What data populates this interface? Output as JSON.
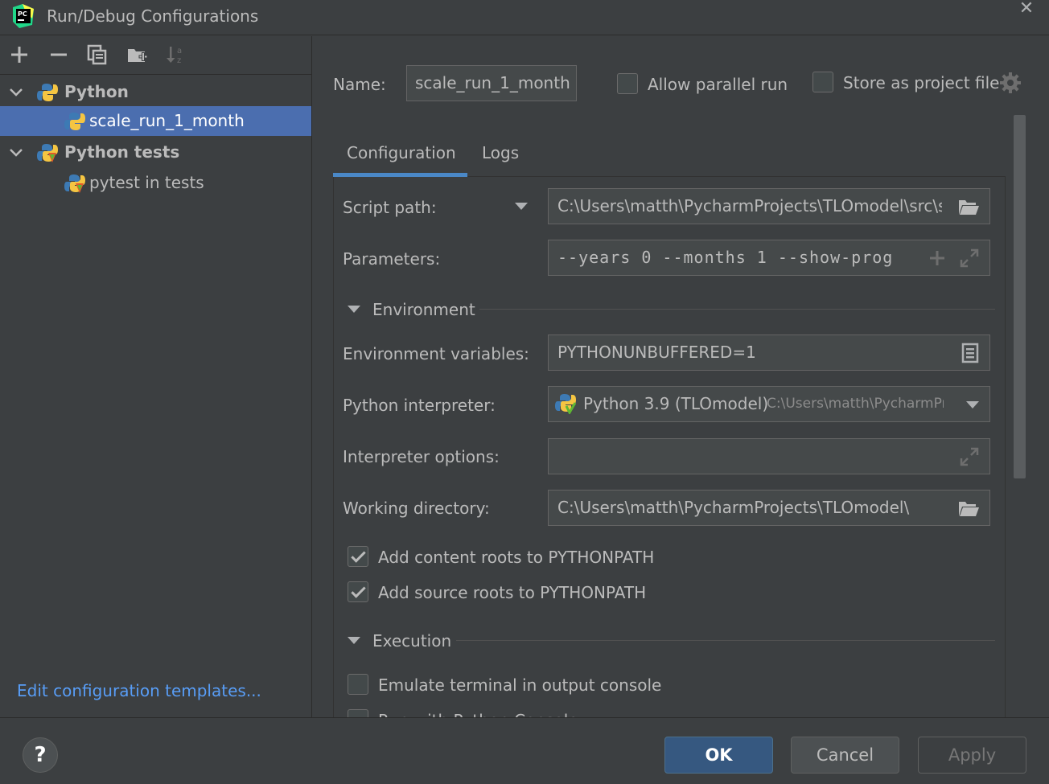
{
  "window": {
    "title": "Run/Debug Configurations",
    "logo_text": "PC",
    "close_glyph": "✕"
  },
  "toolbar": {
    "icons": [
      "add-icon",
      "remove-icon",
      "copy-icon",
      "new-folder-icon",
      "sort-icon"
    ]
  },
  "tree": {
    "items": [
      {
        "label": "Python",
        "icon": "python-icon",
        "expanded": true,
        "bold": true
      },
      {
        "label": "scale_run_1_month",
        "icon": "python-icon",
        "selected": true
      },
      {
        "label": "Python tests",
        "icon": "python-tests-icon",
        "expanded": true,
        "bold": true
      },
      {
        "label": "pytest in tests",
        "icon": "python-tests-icon"
      }
    ]
  },
  "edit_templates_link": "Edit configuration templates...",
  "header": {
    "name_label": "Name:",
    "name_value": "scale_run_1_month",
    "allow_parallel_label": "Allow parallel run",
    "allow_parallel_checked": false,
    "store_project_label": "Store as project file",
    "store_project_checked": false
  },
  "tabs": [
    {
      "label": "Configuration",
      "active": true
    },
    {
      "label": "Logs",
      "active": false
    }
  ],
  "config": {
    "script_path_label": "Script path:",
    "script_path_value": "C:\\Users\\matth\\PycharmProjects\\TLOmodel\\src\\scr",
    "parameters_label": "Parameters:",
    "parameters_value": "--years 0 --months 1 --show-prog",
    "environment_section": "Environment",
    "env_vars_label": "Environment variables:",
    "env_vars_value": "PYTHONUNBUFFERED=1",
    "interpreter_label": "Python interpreter:",
    "interpreter_value": "Python 3.9 (TLOmodel)",
    "interpreter_path": "C:\\Users\\matth\\PycharmPr",
    "interp_options_label": "Interpreter options:",
    "interp_options_value": "",
    "working_dir_label": "Working directory:",
    "working_dir_value": "C:\\Users\\matth\\PycharmProjects\\TLOmodel\\",
    "content_roots_label": "Add content roots to PYTHONPATH",
    "content_roots_checked": true,
    "source_roots_label": "Add source roots to PYTHONPATH",
    "source_roots_checked": true,
    "execution_section": "Execution",
    "emulate_terminal_label": "Emulate terminal in output console",
    "emulate_terminal_checked": false,
    "run_console_label": "Run with Python Console",
    "run_console_checked": false
  },
  "buttons": {
    "help": "?",
    "ok": "OK",
    "cancel": "Cancel",
    "apply": "Apply"
  },
  "colors": {
    "background": "#3c3f41",
    "selection": "#4b6eaf",
    "accent": "#4a88c7",
    "link": "#589df6",
    "ok_button": "#365880"
  }
}
